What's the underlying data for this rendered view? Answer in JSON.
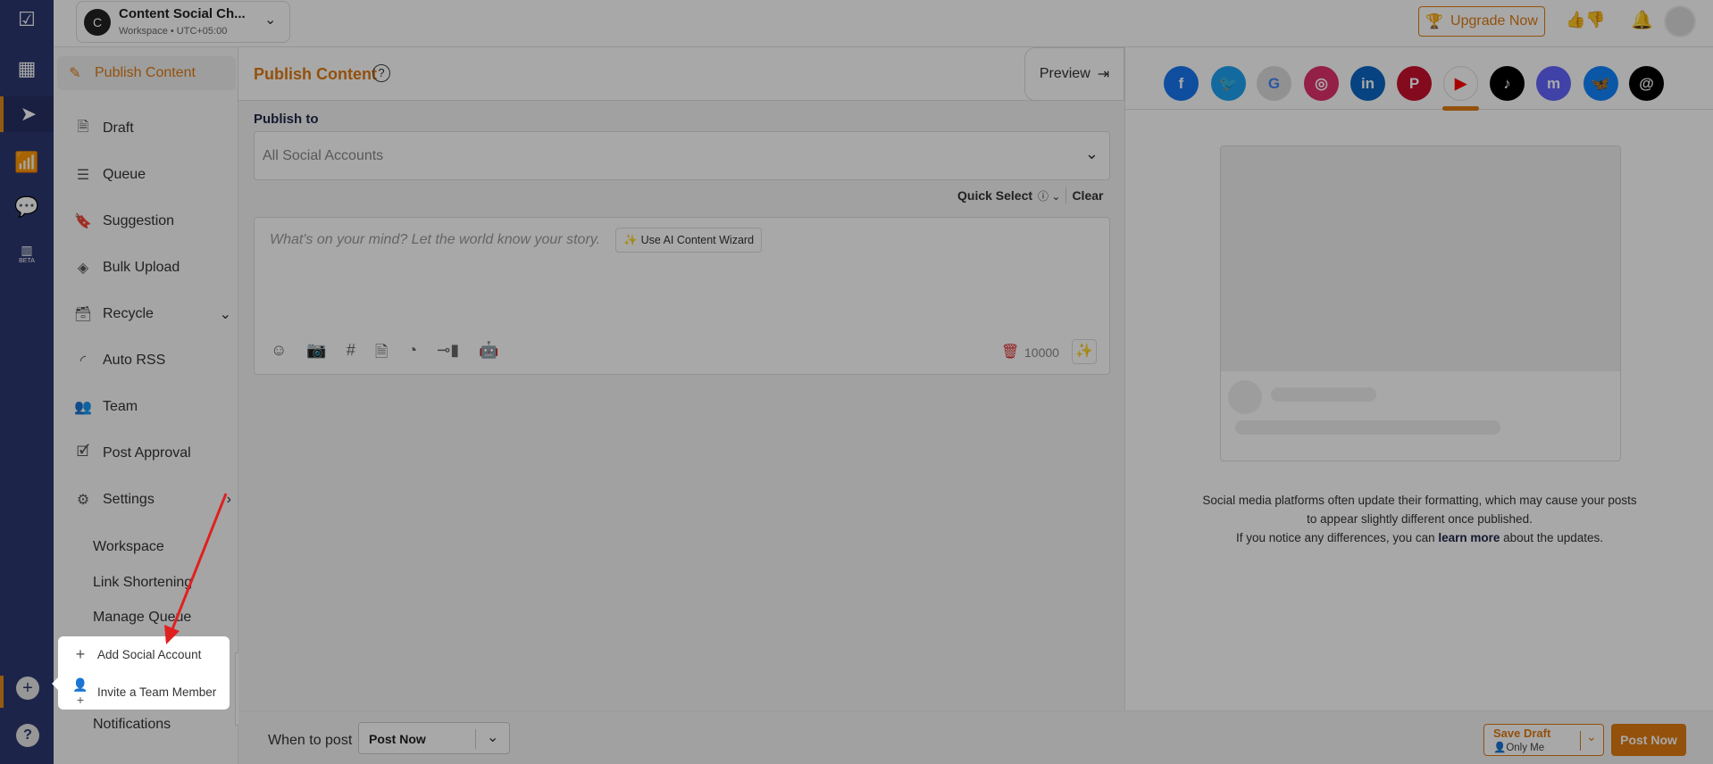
{
  "workspace": {
    "initial": "C",
    "name": "Content Social Ch...",
    "meta": "Workspace • UTC+05:00"
  },
  "topbar": {
    "upgrade": "Upgrade Now"
  },
  "rail": {
    "beta": "BETA"
  },
  "sidebar": {
    "items": [
      {
        "label": "Publish Content",
        "icon": "pencil-icon"
      },
      {
        "label": "Draft",
        "icon": "document-icon"
      },
      {
        "label": "Queue",
        "icon": "list-icon"
      },
      {
        "label": "Suggestion",
        "icon": "bookmark-icon"
      },
      {
        "label": "Bulk Upload",
        "icon": "layers-icon"
      },
      {
        "label": "Recycle",
        "icon": "archive-icon"
      },
      {
        "label": "Auto RSS",
        "icon": "rss-icon"
      },
      {
        "label": "Team",
        "icon": "users-icon"
      },
      {
        "label": "Post Approval",
        "icon": "approval-icon"
      },
      {
        "label": "Settings",
        "icon": "gear-icon"
      }
    ],
    "settings_sub": [
      "Workspace",
      "Link Shortening",
      "Manage Queue",
      "Notifications"
    ]
  },
  "main": {
    "title": "Publish Content",
    "preview": "Preview",
    "publish_to": "Publish to",
    "accounts_placeholder": "All Social Accounts",
    "quick_select": "Quick Select",
    "clear": "Clear",
    "editor_placeholder": "What's on your mind? Let the world know your story.",
    "ai_wizard": "Use AI Content Wizard",
    "char_count": "10000"
  },
  "preview": {
    "platforms": [
      "facebook",
      "twitter",
      "google-business",
      "instagram",
      "linkedin",
      "pinterest",
      "youtube",
      "tiktok",
      "mastodon",
      "bluesky",
      "threads"
    ],
    "active": "youtube",
    "notice_1": "Social media platforms often update their formatting, which may cause your posts",
    "notice_2": "to appear slightly different once published.",
    "notice_3": "If you notice any differences, you can ",
    "learn_more": "learn more",
    "notice_4": " about the updates."
  },
  "bottom": {
    "when_label": "When to post",
    "when_value": "Post Now",
    "save_draft": "Save Draft",
    "visibility": "Only Me",
    "post_now": "Post Now"
  },
  "popup": {
    "add_account": "Add Social Account",
    "invite": "Invite a Team Member"
  },
  "colors": {
    "accent": "#e07b12",
    "rail": "#2c3870",
    "arrow": "#e02020"
  }
}
